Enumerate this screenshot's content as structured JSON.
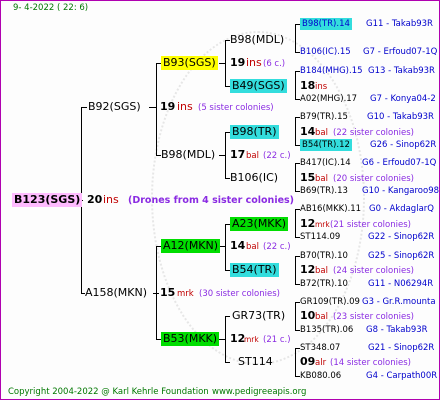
{
  "header": {
    "date": "9- 4-2022 ( 22: 6)"
  },
  "footer": {
    "copyright": "Copyright 2004-2022 @ Karl Kehrle Foundation",
    "website": "www.pedigreeapis.org"
  },
  "root": {
    "id": "B123(SGS)",
    "year": "20",
    "ins": "ins",
    "note": "(Drones from 4 sister colonies)"
  },
  "gen1": [
    {
      "id": "B92(SGS)",
      "year": "19",
      "ins": "ins",
      "note": "(5 sister colonies)"
    },
    {
      "id": "A158(MKN)",
      "year": "15",
      "ins": "mrk",
      "note": "(30 sister colonies)"
    }
  ],
  "gen2": [
    {
      "id": "B93(SGS)"
    },
    {
      "id": "B98(MDL)",
      "year": "17",
      "ins": "bal",
      "note": "(22 c.)"
    },
    {
      "id": "A12(MKN)",
      "year": "14",
      "ins": "bal",
      "note": "(22 c.)"
    },
    {
      "id": "B53(MKK)",
      "year": "12",
      "ins": "mrk",
      "note": "(21 c.)"
    }
  ],
  "gen3": [
    {
      "id": "B98(MDL)",
      "year": "19",
      "ins": "ins",
      "note": "(6 c.)"
    },
    {
      "id": "B49(SGS)",
      "year": "18",
      "ins": "ins"
    },
    {
      "id": "B98(TR)",
      "year": "14",
      "ins": "bal",
      "note": "(22 sister colonies)"
    },
    {
      "id": "B106(IC)",
      "year": "15",
      "ins": "bal",
      "note": "(20 sister colonies)"
    },
    {
      "id": "A23(MKK)",
      "year": "12",
      "ins": "mrk",
      "note": "(21 sister colonies)"
    },
    {
      "id": "B54(TR)",
      "year": "12",
      "ins": "bal",
      "note": "(24 sister colonies)"
    },
    {
      "id": "GR73(TR)",
      "year": "10",
      "ins": "bal",
      "note": "(23 sister colonies)"
    },
    {
      "id": "ST114",
      "year": "09",
      "ins": "alr",
      "note": "(14 sister colonies)"
    }
  ],
  "gen4": [
    {
      "id": "B98(TR).14",
      "src": "G11 - Takab93R"
    },
    {
      "id": "B106(IC).15",
      "src": "G7 - Erfoud07-1Q"
    },
    {
      "id": "B184(MHG).15",
      "src": "G13 - Takab93R"
    },
    {
      "id": "A02(MHG).17",
      "src": "G7 - Konya04-2"
    },
    {
      "id": "B79(TR).15",
      "src": "G10 - Takab93R"
    },
    {
      "id": "B54(TR).12",
      "src": "G26 - Sinop62R"
    },
    {
      "id": "B417(IC).14",
      "src": "G6 - Erfoud07-1Q"
    },
    {
      "id": "B69(TR).13",
      "src": "G10 - Kangaroo98R"
    },
    {
      "id": "AB16(MKK).11",
      "src": "G0 - AkdaglarQ"
    },
    {
      "id": "ST114.09",
      "src": "G22 - Sinop62R"
    },
    {
      "id": "B70(TR).10",
      "src": "G25 - Sinop62R"
    },
    {
      "id": "B72(TR).10",
      "src": "G11 - N06294R"
    },
    {
      "id": "GR109(TR).09",
      "src": "G3 - Gr.R.mounta"
    },
    {
      "id": "B135(TR).06",
      "src": "G8 - Takab93R"
    },
    {
      "id": "ST348.07",
      "src": "G21 - Sinop62R"
    },
    {
      "id": "KB080.06",
      "src": "G4 - Carpath00R"
    }
  ]
}
